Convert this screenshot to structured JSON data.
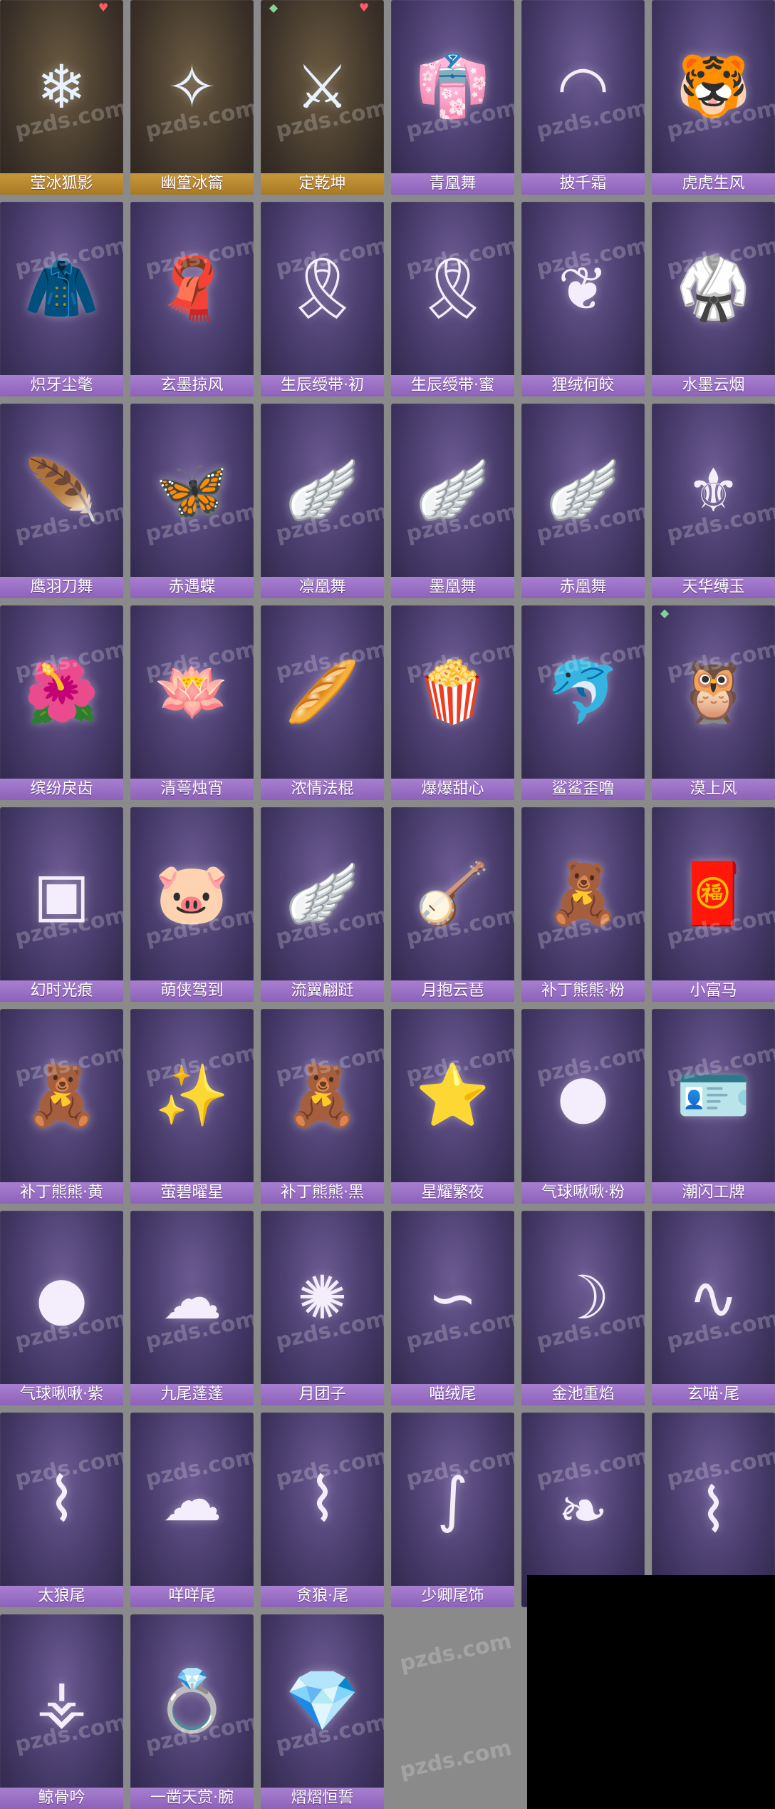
{
  "watermark": "pzds.com",
  "colors": {
    "label_purple": "#9a70c6",
    "label_gold": "#b88a30",
    "heart": "#ff5a6a",
    "gutter": "#8a8a8a"
  },
  "rows": [
    [
      {
        "name": "莹冰狐影",
        "icon": "ice-fox-icon",
        "glyph": "❄",
        "bg": "#4a4035",
        "variant": "gold",
        "badge": "heart"
      },
      {
        "name": "幽篁冰籥",
        "icon": "ice-flute-icon",
        "glyph": "✧",
        "bg": "#4a4035",
        "variant": "gold"
      },
      {
        "name": "定乾坤",
        "icon": "golden-sword-icon",
        "glyph": "⚔",
        "bg": "#4a4035",
        "variant": "gold",
        "badge": "heart",
        "badge2": "tag"
      },
      {
        "name": "青凰舞",
        "icon": "blue-robe-icon",
        "glyph": "👘",
        "bg": "#4a3d70"
      },
      {
        "name": "披千霜",
        "icon": "white-fur-collar-icon",
        "glyph": "◠",
        "bg": "#4a3d70"
      },
      {
        "name": "虎虎生风",
        "icon": "tiger-cape-icon",
        "glyph": "🐯",
        "bg": "#4a3d70"
      }
    ],
    [
      {
        "name": "炽牙尘氅",
        "icon": "brown-cape-icon",
        "glyph": "🧥",
        "bg": "#4a3d70"
      },
      {
        "name": "玄墨掠风",
        "icon": "black-scarf-icon",
        "glyph": "🧣",
        "bg": "#4a3d70"
      },
      {
        "name": "生辰绶带·初",
        "icon": "blue-sash-icon",
        "glyph": "🎗",
        "bg": "#4a3d70"
      },
      {
        "name": "生辰绶带·蜜",
        "icon": "red-sash-icon",
        "glyph": "🎗",
        "bg": "#4a3d70"
      },
      {
        "name": "狸绒何皎",
        "icon": "white-tail-cape-icon",
        "glyph": "❦",
        "bg": "#4a3d70"
      },
      {
        "name": "水墨云烟",
        "icon": "ink-robe-icon",
        "glyph": "🥋",
        "bg": "#4a3d70"
      }
    ],
    [
      {
        "name": "鹰羽刀舞",
        "icon": "black-feather-cape-icon",
        "glyph": "🪶",
        "bg": "#4a3d70"
      },
      {
        "name": "赤遇蝶",
        "icon": "red-butterfly-cape-icon",
        "glyph": "🦋",
        "bg": "#4a3d70"
      },
      {
        "name": "凛凰舞",
        "icon": "white-wing-cape-icon",
        "glyph": "🪽",
        "bg": "#4a3d70"
      },
      {
        "name": "墨凰舞",
        "icon": "dark-wing-cape-icon",
        "glyph": "🪽",
        "bg": "#4a3d70"
      },
      {
        "name": "赤凰舞",
        "icon": "red-wing-cape-icon",
        "glyph": "🪽",
        "bg": "#4a3d70"
      },
      {
        "name": "天华缚玉",
        "icon": "jade-pendant-icon",
        "glyph": "⚜",
        "bg": "#4a3d70"
      }
    ],
    [
      {
        "name": "缤纷戾齿",
        "icon": "flower-plant-icon",
        "glyph": "🌺",
        "bg": "#4a3d70"
      },
      {
        "name": "清萼烛宵",
        "icon": "lotus-pendant-icon",
        "glyph": "🪷",
        "bg": "#4a3d70"
      },
      {
        "name": "浓情法棍",
        "icon": "baguette-bag-icon",
        "glyph": "🥖",
        "bg": "#4a3d70"
      },
      {
        "name": "爆爆甜心",
        "icon": "popcorn-icon",
        "glyph": "🍿",
        "bg": "#4a3d70"
      },
      {
        "name": "鲨鲨歪噜",
        "icon": "shark-plush-icon",
        "glyph": "🐬",
        "bg": "#4a3d70"
      },
      {
        "name": "漠上风",
        "icon": "owl-icon",
        "glyph": "🦉",
        "bg": "#4a3d70",
        "badge2": "tag"
      }
    ],
    [
      {
        "name": "幻时光痕",
        "icon": "black-badge-icon",
        "glyph": "▣",
        "bg": "#4a3d70"
      },
      {
        "name": "萌侠驾到",
        "icon": "red-pig-icon",
        "glyph": "🐷",
        "bg": "#4a3d70"
      },
      {
        "name": "流翼翩跹",
        "icon": "white-wings-icon",
        "glyph": "🪽",
        "bg": "#4a3d70"
      },
      {
        "name": "月抱云琶",
        "icon": "pipa-icon",
        "glyph": "🪕",
        "bg": "#4a3d70"
      },
      {
        "name": "补丁熊熊·粉",
        "icon": "pink-bear-icon",
        "glyph": "🧸",
        "bg": "#4a3d70"
      },
      {
        "name": "小富马",
        "icon": "red-horse-charm-icon",
        "glyph": "🧧",
        "bg": "#4a3d70"
      }
    ],
    [
      {
        "name": "补丁熊熊·黄",
        "icon": "yellow-bear-icon",
        "glyph": "🧸",
        "bg": "#4a3d70"
      },
      {
        "name": "萤碧曜星",
        "icon": "green-star-wand-icon",
        "glyph": "✨",
        "bg": "#4a3d70"
      },
      {
        "name": "补丁熊熊·黑",
        "icon": "black-bear-icon",
        "glyph": "🧸",
        "bg": "#4a3d70"
      },
      {
        "name": "星耀繁夜",
        "icon": "star-lightstick-icon",
        "glyph": "⭐",
        "bg": "#4a3d70"
      },
      {
        "name": "气球啾啾·粉",
        "icon": "pink-balloon-icon",
        "glyph": "●",
        "bg": "#4a3d70"
      },
      {
        "name": "潮闪工牌",
        "icon": "id-card-icon",
        "glyph": "🪪",
        "bg": "#4a3d70"
      }
    ],
    [
      {
        "name": "气球啾啾·紫",
        "icon": "purple-balloon-icon",
        "glyph": "●",
        "bg": "#4a3d70"
      },
      {
        "name": "九尾蓬蓬",
        "icon": "nine-tails-icon",
        "glyph": "☁",
        "bg": "#4a3d70"
      },
      {
        "name": "月团子",
        "icon": "fluffy-ball-icon",
        "glyph": "✺",
        "bg": "#4a3d70"
      },
      {
        "name": "喵绒尾",
        "icon": "cat-tail-icon",
        "glyph": "∽",
        "bg": "#4a3d70"
      },
      {
        "name": "金池重焰",
        "icon": "golden-tail-icon",
        "glyph": "☽",
        "bg": "#4a3d70"
      },
      {
        "name": "玄喵·尾",
        "icon": "black-cat-tail-icon",
        "glyph": "∿",
        "bg": "#4a3d70"
      }
    ],
    [
      {
        "name": "太狼尾",
        "icon": "wolf-tail-icon",
        "glyph": "⌇",
        "bg": "#4a3d70"
      },
      {
        "name": "咩咩尾",
        "icon": "sheep-tail-icon",
        "glyph": "☁",
        "bg": "#4a3d70"
      },
      {
        "name": "贪狼·尾",
        "icon": "dark-tail-icon",
        "glyph": "⌇",
        "bg": "#4a3d70"
      },
      {
        "name": "少卿尾饰",
        "icon": "white-tail-icon",
        "glyph": "∫",
        "bg": "#4a3d70"
      },
      {
        "name": "",
        "icon": "red-tail-icon",
        "glyph": "❧",
        "bg": "#4a3d70",
        "nolabel": true
      },
      {
        "name": "",
        "icon": "raccoon-tail-icon",
        "glyph": "⌇",
        "bg": "#4a3d70",
        "nolabel": true
      }
    ],
    [
      {
        "name": "鲸骨吟",
        "icon": "bone-pendant-icon",
        "glyph": "⚶",
        "bg": "#4a3d70"
      },
      {
        "name": "一凿天赏·腕",
        "icon": "emerald-ring-icon",
        "glyph": "💍",
        "bg": "#4a3d70"
      },
      {
        "name": "熠熠恒誓",
        "icon": "diamond-ring-icon",
        "glyph": "💎",
        "bg": "#4a3d70"
      }
    ]
  ]
}
